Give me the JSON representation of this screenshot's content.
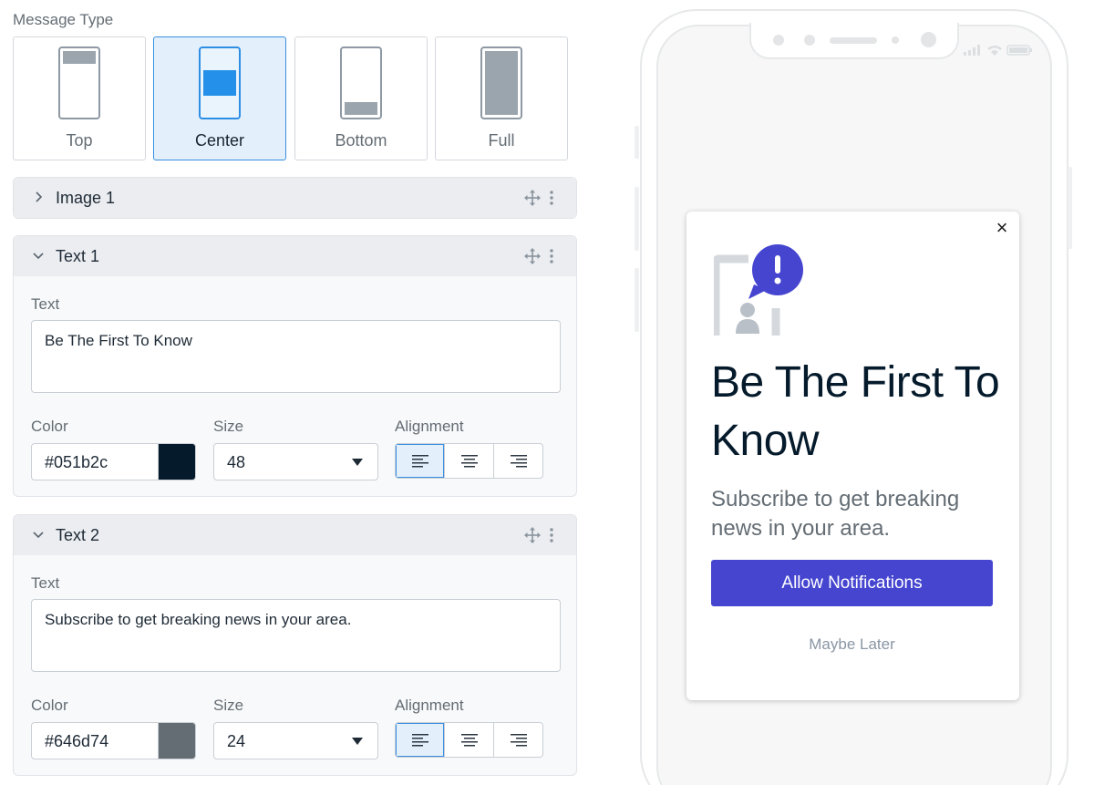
{
  "editor": {
    "message_type_label": "Message Type",
    "types": [
      {
        "label": "Top",
        "selected": false
      },
      {
        "label": "Center",
        "selected": true
      },
      {
        "label": "Bottom",
        "selected": false
      },
      {
        "label": "Full",
        "selected": false
      }
    ],
    "panels": {
      "image1": {
        "title": "Image 1",
        "expanded": false
      },
      "text1": {
        "title": "Text 1",
        "expanded": true,
        "text_label": "Text",
        "text_value": "Be The First To Know",
        "color_label": "Color",
        "color_value": "#051b2c",
        "size_label": "Size",
        "size_value": "48",
        "alignment_label": "Alignment",
        "alignment_selected": "left"
      },
      "text2": {
        "title": "Text 2",
        "expanded": true,
        "text_label": "Text",
        "text_value": "Subscribe to get breaking news in your area.",
        "color_label": "Color",
        "color_value": "#646d74",
        "size_label": "Size",
        "size_value": "24",
        "alignment_label": "Alignment",
        "alignment_selected": "left"
      }
    },
    "icons": {
      "chevron_collapsed": "chevron-right-icon",
      "chevron_expanded": "chevron-down-icon",
      "move": "move-icon",
      "more": "more-vertical-icon",
      "align": [
        "align-left-icon",
        "align-center-icon",
        "align-right-icon"
      ]
    }
  },
  "preview": {
    "headline": "Be The First To Know",
    "subtext": "Subscribe to get breaking news in your area.",
    "cta_label": "Allow Notifications",
    "secondary_label": "Maybe Later",
    "close_glyph": "×",
    "colors": {
      "headline": "#051b2c",
      "subtext": "#646d74",
      "cta_bg": "#4645d0",
      "accent": "#2490ea"
    }
  }
}
